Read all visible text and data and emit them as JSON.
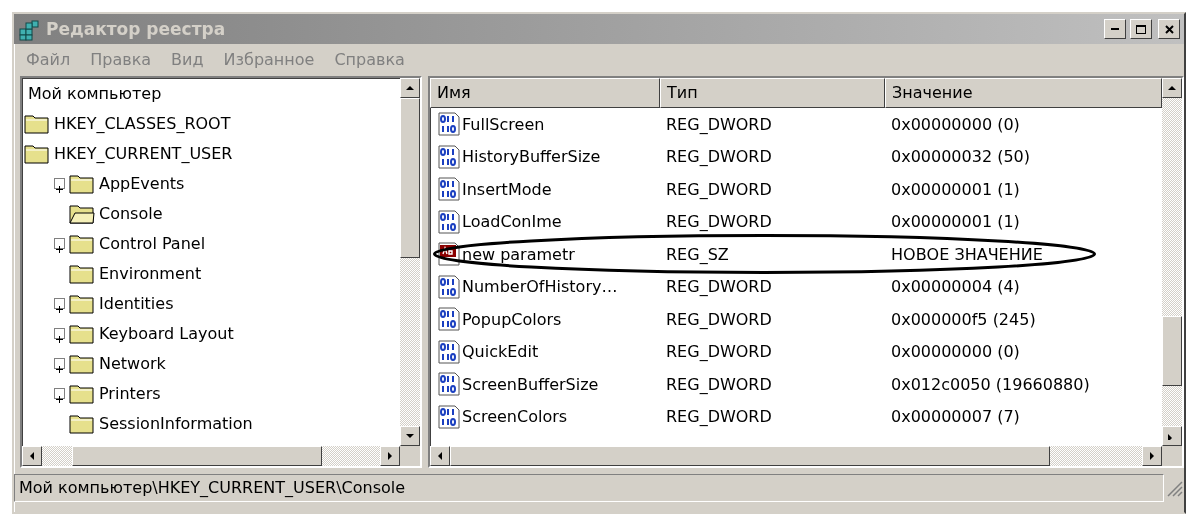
{
  "window": {
    "title": "Редактор реестра"
  },
  "menu": [
    "Файл",
    "Правка",
    "Вид",
    "Избранное",
    "Справка"
  ],
  "tree": {
    "label": "Мой компьютер",
    "children": [
      {
        "label": "HKEY_CLASSES_ROOT",
        "expandable": false,
        "open": false
      },
      {
        "label": "HKEY_CURRENT_USER",
        "expandable": false,
        "open": false,
        "children": [
          {
            "label": "AppEvents",
            "expandable": true,
            "open": false
          },
          {
            "label": "Console",
            "expandable": false,
            "open": true
          },
          {
            "label": "Control Panel",
            "expandable": true,
            "open": false
          },
          {
            "label": "Environment",
            "expandable": false,
            "open": false
          },
          {
            "label": "Identities",
            "expandable": true,
            "open": false
          },
          {
            "label": "Keyboard Layout",
            "expandable": true,
            "open": false
          },
          {
            "label": "Network",
            "expandable": true,
            "open": false
          },
          {
            "label": "Printers",
            "expandable": true,
            "open": false
          },
          {
            "label": "SessionInformation",
            "expandable": false,
            "open": false
          }
        ]
      }
    ]
  },
  "list": {
    "columns": [
      "Имя",
      "Тип",
      "Значение"
    ],
    "rows": [
      {
        "kind": "dword",
        "name": "FullScreen",
        "type": "REG_DWORD",
        "value": "0x00000000 (0)",
        "highlighted": false
      },
      {
        "kind": "dword",
        "name": "HistoryBufferSize",
        "type": "REG_DWORD",
        "value": "0x00000032 (50)",
        "highlighted": false
      },
      {
        "kind": "dword",
        "name": "InsertMode",
        "type": "REG_DWORD",
        "value": "0x00000001 (1)",
        "highlighted": false
      },
      {
        "kind": "dword",
        "name": "LoadConIme",
        "type": "REG_DWORD",
        "value": "0x00000001 (1)",
        "highlighted": false
      },
      {
        "kind": "string",
        "name": "new parametr",
        "type": "REG_SZ",
        "value": "НОВОЕ ЗНАЧЕНИЕ",
        "highlighted": true
      },
      {
        "kind": "dword",
        "name": "NumberOfHistory…",
        "type": "REG_DWORD",
        "value": "0x00000004 (4)",
        "highlighted": false
      },
      {
        "kind": "dword",
        "name": "PopupColors",
        "type": "REG_DWORD",
        "value": "0x000000f5 (245)",
        "highlighted": false
      },
      {
        "kind": "dword",
        "name": "QuickEdit",
        "type": "REG_DWORD",
        "value": "0x00000000 (0)",
        "highlighted": false
      },
      {
        "kind": "dword",
        "name": "ScreenBufferSize",
        "type": "REG_DWORD",
        "value": "0x012c0050 (19660880)",
        "highlighted": false
      },
      {
        "kind": "dword",
        "name": "ScreenColors",
        "type": "REG_DWORD",
        "value": "0x00000007 (7)",
        "highlighted": false
      }
    ]
  },
  "status_bar": "Мой компьютер\\HKEY_CURRENT_USER\\Console"
}
